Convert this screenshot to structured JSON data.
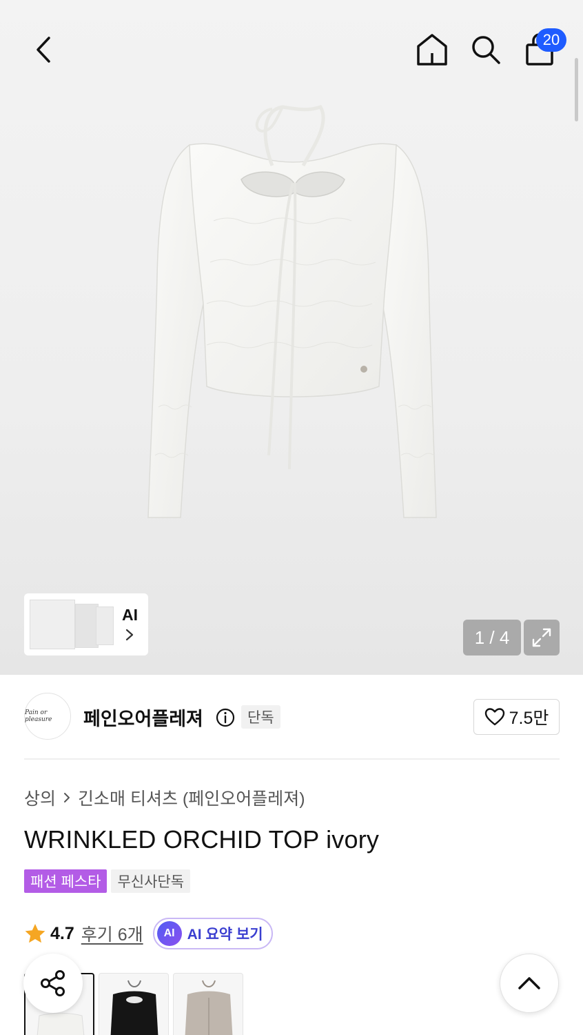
{
  "header": {
    "cart_count": "20"
  },
  "gallery": {
    "ai_label": "AI",
    "pager": "1 / 4"
  },
  "brand": {
    "logo_text": "Pain or pleasure",
    "name": "페인오어플레져",
    "exclusive_label": "단독",
    "likes": "7.5만"
  },
  "breadcrumb": {
    "category": "상의",
    "subcategory": "긴소매 티셔츠 (페인오어플레져)"
  },
  "product": {
    "title": "WRINKLED ORCHID TOP ivory",
    "tags": [
      "패션 페스타",
      "무신사단독"
    ],
    "rating": "4.7",
    "reviews": "후기 6개",
    "ai_summary_badge": "AI",
    "ai_summary_label": "AI 요약 보기"
  },
  "colors": {
    "accent_blue": "#1f5cff",
    "festa_purple": "#b35ce6",
    "star": "#f5a623"
  },
  "icons": {
    "back": "chevron-left-icon",
    "home": "home-icon",
    "search": "search-icon",
    "cart": "shopping-bag-icon",
    "expand": "expand-icon",
    "info": "info-icon",
    "heart": "heart-icon",
    "star": "star-icon",
    "share": "share-icon",
    "scroll_top": "chevron-up-icon"
  }
}
